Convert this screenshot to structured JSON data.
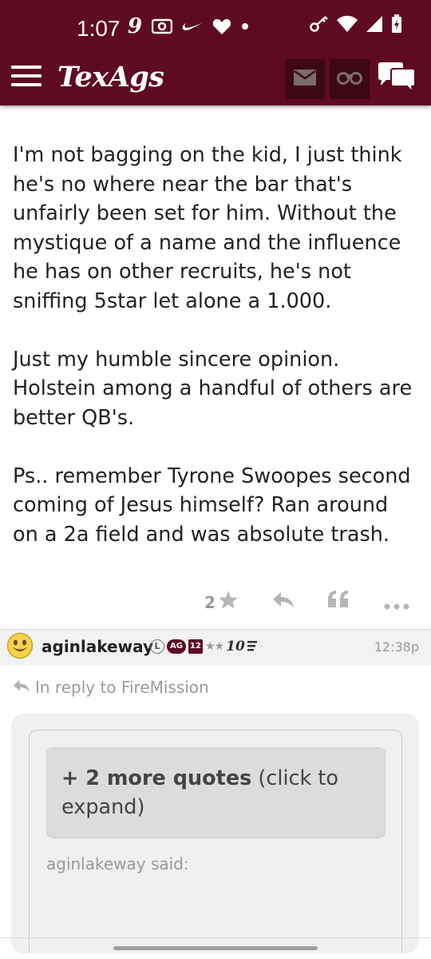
{
  "status_bar": {
    "time": "1:07",
    "icons_left": [
      "nine-app-icon",
      "radio-icon",
      "nike-icon",
      "heart-icon",
      "dot-icon"
    ],
    "icons_right": [
      "key-icon",
      "wifi-icon",
      "signal-icon",
      "battery-icon"
    ]
  },
  "app_bar": {
    "logo": "TexAgs",
    "background": "#5e0a23",
    "buttons": [
      "menu-icon",
      "mail-icon",
      "binoculars-icon",
      "chat-icon"
    ]
  },
  "post": {
    "paragraphs": [
      "I'm not bagging on the kid, I just think he's no where near the bar that's unfairly been set for him. Without the mystique of a name and the influence he has on other recruits, he's not sniffing 5star let alone a 1.000.",
      "Just my humble sincere opinion. Holstein among a handful of others are better QB's.",
      "Ps.. remember Tyrone Swoopes second coming of Jesus himself? Ran around on a 2a field and was absolute trash."
    ],
    "like_count": "2"
  },
  "next_post": {
    "username": "aginlakeway",
    "badge_l": "L",
    "badge_ag": "AG",
    "badge_12": "12",
    "badge_stars": "★★",
    "badge_rank": "10",
    "time": "12:38p",
    "reply_to": "In reply to FireMission",
    "more_quotes_bold": "+ 2 more quotes",
    "more_quotes_rest": " (click to expand)",
    "quote_author": "aginlakeway said:"
  }
}
